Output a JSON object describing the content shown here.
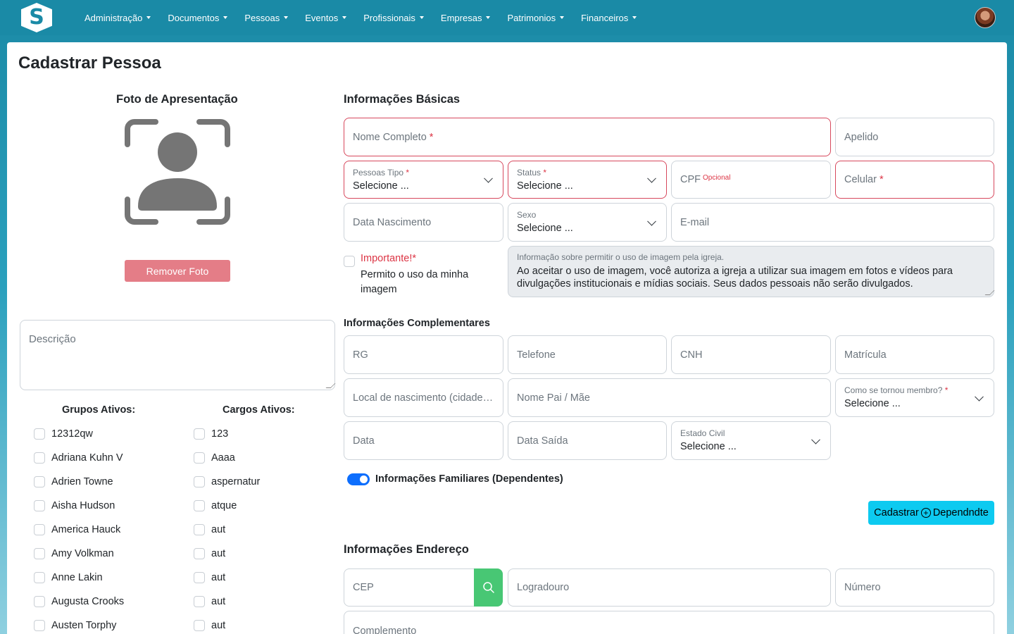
{
  "nav": {
    "logo": "S",
    "items": [
      "Administração",
      "Documentos",
      "Pessoas",
      "Eventos",
      "Profissionais",
      "Empresas",
      "Patrimonios",
      "Financeiros"
    ]
  },
  "page": {
    "title": "Cadastrar Pessoa"
  },
  "photo": {
    "title": "Foto de Apresentação",
    "remove_label": "Remover Foto"
  },
  "description": {
    "placeholder": "Descrição"
  },
  "groups": {
    "title": "Grupos Ativos:",
    "items": [
      "12312qw",
      "Adriana Kuhn V",
      "Adrien Towne",
      "Aisha Hudson",
      "America Hauck",
      "Amy Volkman",
      "Anne Lakin",
      "Augusta Crooks",
      "Austen Torphy"
    ]
  },
  "cargos": {
    "title": "Cargos Ativos:",
    "items": [
      "123",
      "Aaaa",
      "aspernatur",
      "atque",
      "aut",
      "aut",
      "aut",
      "aut",
      "aut"
    ]
  },
  "basic": {
    "title": "Informações Básicas",
    "nome": "Nome Completo",
    "apelido": "Apelido",
    "pessoas_tipo_label": "Pessoas Tipo",
    "pessoas_tipo_value": "Selecione ...",
    "status_label": "Status",
    "status_value": "Selecione ...",
    "cpf": "CPF",
    "cpf_optional": "Opcional",
    "celular": "Celular",
    "data_nascimento": "Data Nascimento",
    "sexo_label": "Sexo",
    "sexo_value": "Selecione ...",
    "email": "E-mail",
    "required_mark": "*",
    "important_title": "Importante!*",
    "important_text": "Permito o uso da minha imagem",
    "consent_label": "Informação sobre permitir o uso de imagem pela igreja.",
    "consent_text": "Ao aceitar o uso de imagem, você autoriza a igreja a utilizar sua imagem em fotos e vídeos para divulgações institucionais e mídias sociais. Seus dados pessoais não serão divulgados."
  },
  "complementary": {
    "title": "Informações Complementares",
    "rg": "RG",
    "telefone": "Telefone",
    "cnh": "CNH",
    "matricula": "Matrícula",
    "local_nascimento": "Local de nascimento (cidade - estado)",
    "nome_pai_mae": "Nome Pai / Mãe",
    "membro_label": "Como se tornou membro?",
    "membro_value": "Selecione ...",
    "data": "Data",
    "data_saida": "Data Saída",
    "estado_civil_label": "Estado Civil",
    "estado_civil_value": "Selecione ..."
  },
  "family": {
    "toggle_label": "Informações Familiares (Dependentes)",
    "toggle_on": true,
    "button_pre": "Cadastrar",
    "button_post": "Dependndte"
  },
  "address": {
    "title": "Informações Endereço",
    "cep": "CEP",
    "logradouro": "Logradouro",
    "numero": "Número",
    "complemento": "Complemento"
  },
  "colors": {
    "primary": "#1a8aa6",
    "danger": "#dc3545",
    "info": "#0dcaf0",
    "success": "#48c774",
    "remove": "#e47d87"
  }
}
